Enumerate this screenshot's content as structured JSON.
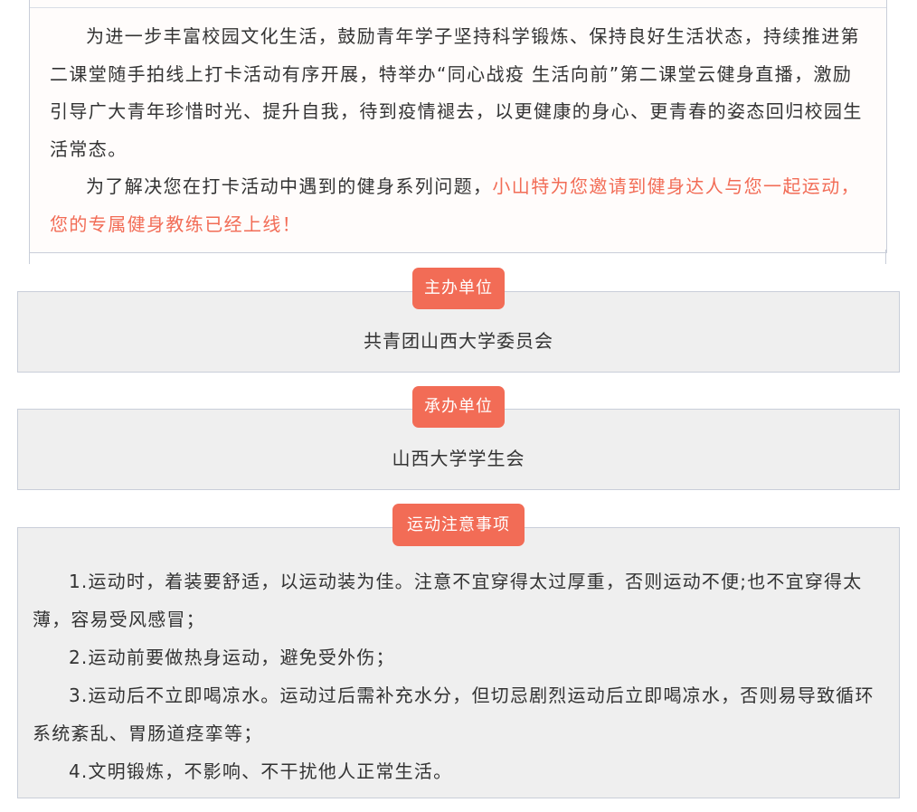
{
  "intro": {
    "paragraph_1": "为进一步丰富校园文化生活，鼓励青年学子坚持科学锻炼、保持良好生活状态，持续推进第二课堂随手拍线上打卡活动有序开展，特举办“同心战疫 生活向前”第二课堂云健身直播，激励引导广大青年珍惜时光、提升自我，待到疫情褪去，以更健康的身心、更青春的姿态回归校园生活常态。",
    "paragraph_2_plain": "为了解决您在打卡活动中遇到的健身系列问题，",
    "paragraph_2_highlight": "小山特为您邀请到健身达人与您一起运动，您的专属健身教练已经上线！"
  },
  "organizer": {
    "label": "主办单位",
    "value": "共青团山西大学委员会"
  },
  "co_organizer": {
    "label": "承办单位",
    "value": "山西大学学生会"
  },
  "notes": {
    "label": "运动注意事项",
    "items": [
      "1.运动时，着装要舒适，以运动装为佳。注意不宜穿得太过厚重，否则运动不便;也不宜穿得太薄，容易受风感冒；",
      "2.运动前要做热身运动，避免受外伤；",
      "3.运动后不立即喝凉水。运动过后需补充水分，但切忌剧烈运动后立即喝凉水，否则易导致循环系统紊乱、胃肠道痉挛等；",
      "4.文明锻炼，不影响、不干扰他人正常生活。"
    ]
  },
  "colors": {
    "accent": "#f26c56",
    "box_background": "#efefef",
    "border": "#c9ced9",
    "text": "#333333"
  }
}
